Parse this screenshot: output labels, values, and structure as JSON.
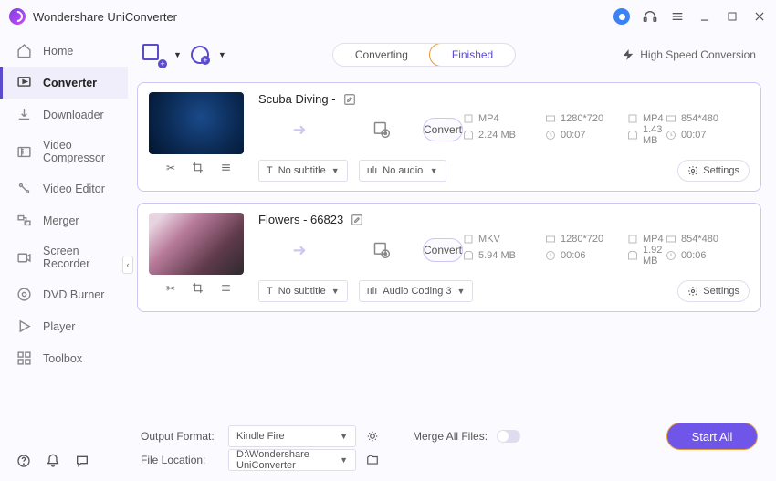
{
  "app": {
    "name": "Wondershare UniConverter"
  },
  "sidebar": {
    "items": [
      {
        "label": "Home"
      },
      {
        "label": "Converter"
      },
      {
        "label": "Downloader"
      },
      {
        "label": "Video Compressor"
      },
      {
        "label": "Video Editor"
      },
      {
        "label": "Merger"
      },
      {
        "label": "Screen Recorder"
      },
      {
        "label": "DVD Burner"
      },
      {
        "label": "Player"
      },
      {
        "label": "Toolbox"
      }
    ]
  },
  "topbar": {
    "tab_converting": "Converting",
    "tab_finished": "Finished",
    "highspeed": "High Speed Conversion"
  },
  "files": [
    {
      "title": "Scuba Diving -",
      "src": {
        "fmt": "MP4",
        "res": "1280*720",
        "size": "2.24 MB",
        "dur": "00:07"
      },
      "dst": {
        "fmt": "MP4",
        "res": "854*480",
        "size": "1.43 MB",
        "dur": "00:07"
      },
      "subtitle": "No subtitle",
      "audio": "No audio",
      "settings": "Settings",
      "convert": "Convert"
    },
    {
      "title": "Flowers - 66823",
      "src": {
        "fmt": "MKV",
        "res": "1280*720",
        "size": "5.94 MB",
        "dur": "00:06"
      },
      "dst": {
        "fmt": "MP4",
        "res": "854*480",
        "size": "1.92 MB",
        "dur": "00:06"
      },
      "subtitle": "No subtitle",
      "audio": "Audio Coding 3",
      "settings": "Settings",
      "convert": "Convert"
    }
  ],
  "bottom": {
    "output_label": "Output Format:",
    "output_value": "Kindle Fire",
    "location_label": "File Location:",
    "location_value": "D:\\Wondershare UniConverter",
    "merge_label": "Merge All Files:",
    "start_all": "Start All"
  }
}
